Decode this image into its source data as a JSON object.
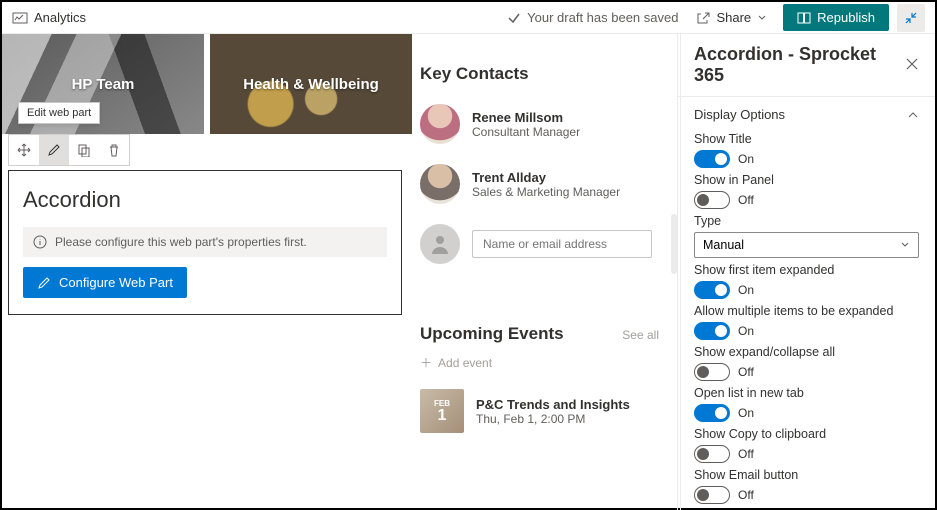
{
  "topbar": {
    "app_title": "Analytics",
    "saved_msg": "Your draft has been saved",
    "share_label": "Share",
    "republish_label": "Republish"
  },
  "tiles": {
    "hp_label": "HP Team",
    "hw_label": "Health & Wellbeing"
  },
  "tooltip": {
    "edit_wp": "Edit web part"
  },
  "webpart": {
    "title": "Accordion",
    "config_msg": "Please configure this web part's properties first.",
    "config_btn": "Configure Web Part"
  },
  "contacts": {
    "heading": "Key Contacts",
    "items": [
      {
        "name": "Renee Millsom",
        "role": "Consultant Manager"
      },
      {
        "name": "Trent Allday",
        "role": "Sales & Marketing Manager"
      }
    ],
    "search_placeholder": "Name or email address"
  },
  "events": {
    "heading": "Upcoming Events",
    "see_all": "See all",
    "add_label": "Add event",
    "items": [
      {
        "month": "FEB",
        "day": "1",
        "title": "P&C Trends and Insights",
        "when": "Thu, Feb 1, 2:00 PM"
      }
    ]
  },
  "panel": {
    "title": "Accordion - Sprocket 365",
    "section": "Display Options",
    "type_label": "Type",
    "type_value": "Manual",
    "on": "On",
    "off": "Off",
    "opts": [
      {
        "label": "Show Title",
        "on": true
      },
      {
        "label": "Show in Panel",
        "on": false
      },
      {
        "label": "Show first item expanded",
        "on": true
      },
      {
        "label": "Allow multiple items to be expanded",
        "on": true
      },
      {
        "label": "Show expand/collapse all",
        "on": false
      },
      {
        "label": "Open list in new tab",
        "on": true
      },
      {
        "label": "Show Copy to clipboard",
        "on": false
      },
      {
        "label": "Show Email button",
        "on": false
      }
    ]
  }
}
